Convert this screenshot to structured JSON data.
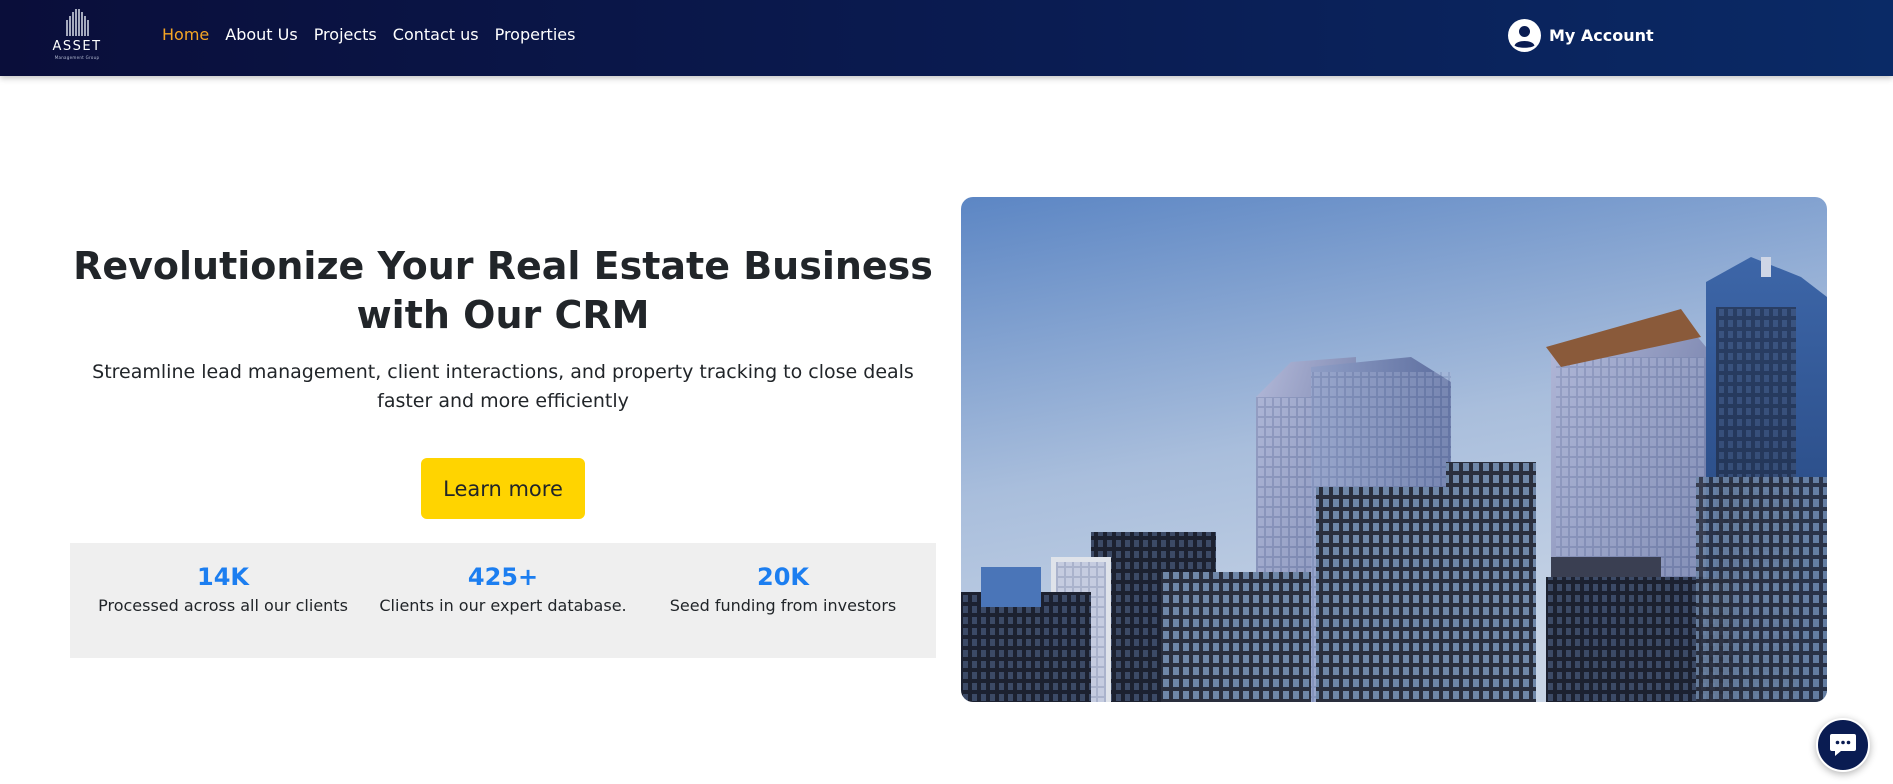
{
  "brand": {
    "logo_text": "ASSET",
    "logo_subtext": "Management Group"
  },
  "nav": {
    "links": [
      {
        "label": "Home",
        "active": true
      },
      {
        "label": "About Us",
        "active": false
      },
      {
        "label": "Projects",
        "active": false
      },
      {
        "label": "Contact us",
        "active": false
      },
      {
        "label": "Properties",
        "active": false
      }
    ],
    "account_label": "My Account",
    "account_icon": "user-circle-icon"
  },
  "hero": {
    "title": "Revolutionize Your Real Estate Business with Our CRM",
    "subtitle": "Streamline lead management, client interactions, and property tracking to close deals faster and more efficiently",
    "cta_label": "Learn more",
    "image_subject": "city skyscrapers"
  },
  "stats": [
    {
      "value": "14K",
      "label": "Processed across all our clients"
    },
    {
      "value": "425+",
      "label": "Clients in our expert database."
    },
    {
      "value": "20K",
      "label": "Seed funding from investors"
    }
  ],
  "chat": {
    "icon": "chat-bubble-icon"
  },
  "colors": {
    "nav_bg": "#0a1c52",
    "active_link": "#f5a524",
    "cta_bg": "#ffd400",
    "stat_value": "#1c7ef0",
    "stats_bg": "#efefef"
  }
}
